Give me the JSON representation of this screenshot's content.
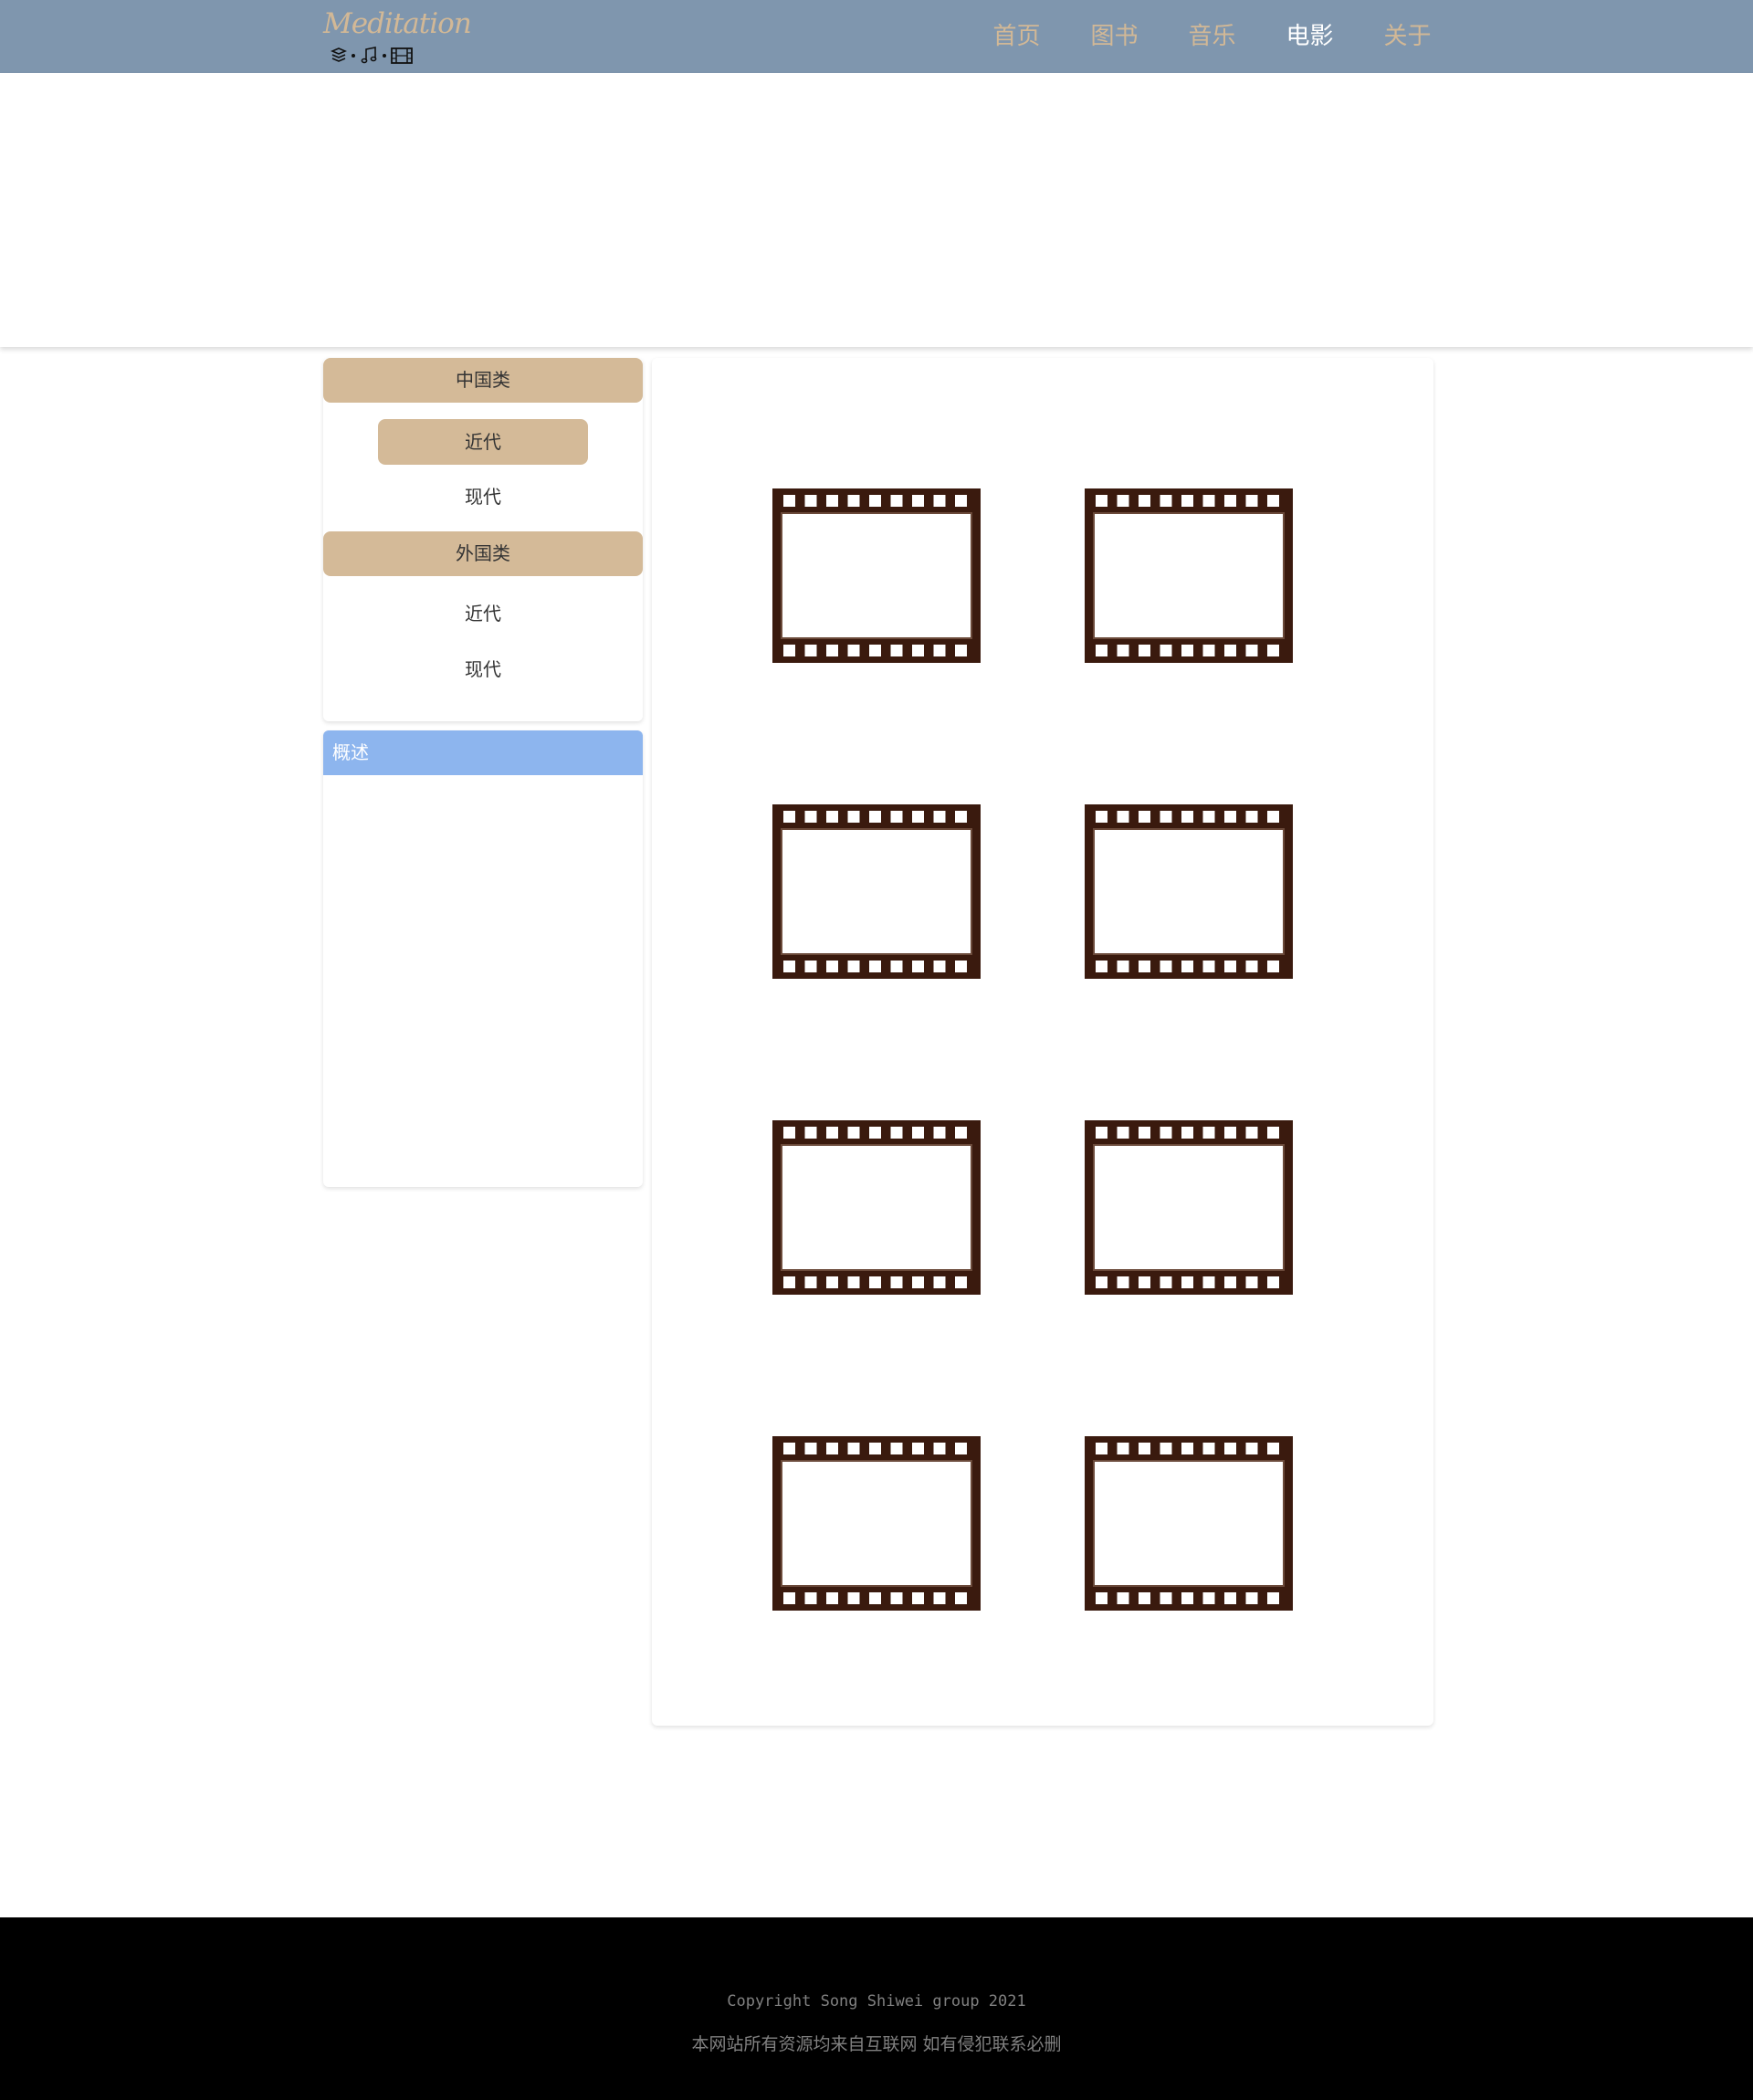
{
  "header": {
    "logo_text": "Meditation",
    "logo_icons": [
      "books-icon",
      "music-note-icon",
      "film-icon"
    ],
    "nav": [
      {
        "label": "首页",
        "active": false
      },
      {
        "label": "图书",
        "active": false
      },
      {
        "label": "音乐",
        "active": false
      },
      {
        "label": "电影",
        "active": true
      },
      {
        "label": "关于",
        "active": false
      }
    ]
  },
  "sidebar": {
    "categories": [
      {
        "title": "中国类",
        "items": [
          {
            "label": "近代",
            "active": true
          },
          {
            "label": "现代",
            "active": false
          }
        ]
      },
      {
        "title": "外国类",
        "items": [
          {
            "label": "近代",
            "active": false
          },
          {
            "label": "现代",
            "active": false
          }
        ]
      }
    ],
    "summary_title": "概述"
  },
  "main": {
    "movies": [
      {
        "icon": "film-frame-icon"
      },
      {
        "icon": "film-frame-icon"
      },
      {
        "icon": "film-frame-icon"
      },
      {
        "icon": "film-frame-icon"
      },
      {
        "icon": "film-frame-icon"
      },
      {
        "icon": "film-frame-icon"
      },
      {
        "icon": "film-frame-icon"
      },
      {
        "icon": "film-frame-icon"
      }
    ]
  },
  "footer": {
    "copyright": "Copyright Song Shiwei group 2021",
    "disclaimer": "本网站所有资源均来自互联网 如有侵犯联系必删"
  },
  "colors": {
    "nav_bg": "#7f96ae",
    "accent_tan": "#d4ba98",
    "summary_blue": "#8db5ee",
    "film_brown": "#3a1a0e",
    "footer_bg": "#000000"
  }
}
